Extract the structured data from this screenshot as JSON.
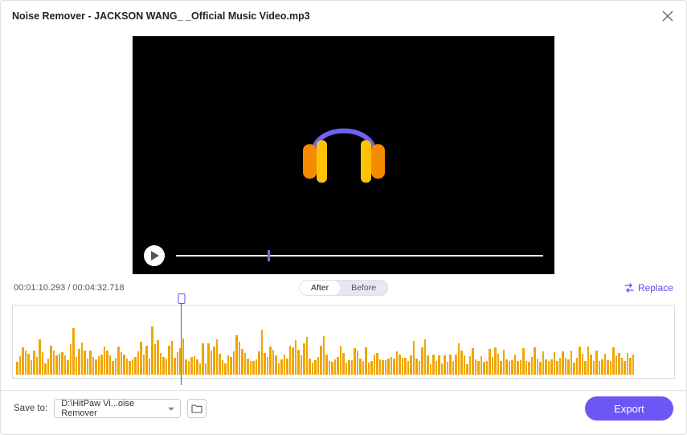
{
  "header": {
    "title": "Noise Remover - JACKSON WANG_ _Official Music Video.mp3"
  },
  "player": {
    "progress_percent": 25
  },
  "timecodes": {
    "current": "00:01:10.293",
    "total": "00:04:32.718",
    "separator": " / "
  },
  "toggle": {
    "after": "After",
    "before": "Before",
    "active": "after"
  },
  "replace_label": "Replace",
  "playhead_percent": 25.5,
  "waveform_heights": [
    16,
    23,
    34,
    30,
    26,
    18,
    30,
    22,
    44,
    28,
    14,
    20,
    36,
    30,
    24,
    26,
    28,
    24,
    18,
    38,
    58,
    22,
    32,
    40,
    30,
    20,
    30,
    22,
    19,
    23,
    25,
    35,
    30,
    24,
    17,
    21,
    35,
    28,
    25,
    20,
    17,
    19,
    22,
    29,
    41,
    25,
    36,
    20,
    60,
    38,
    43,
    27,
    22,
    20,
    36,
    42,
    21,
    28,
    33,
    45,
    19,
    17,
    22,
    23,
    19,
    14,
    39,
    14,
    39,
    30,
    35,
    44,
    26,
    18,
    14,
    24,
    22,
    29,
    49,
    41,
    32,
    27,
    20,
    17,
    17,
    19,
    29,
    56,
    27,
    22,
    35,
    31,
    24,
    14,
    19,
    25,
    20,
    36,
    34,
    43,
    31,
    24,
    39,
    47,
    20,
    15,
    18,
    22,
    36,
    48,
    25,
    17,
    16,
    19,
    22,
    36,
    27,
    15,
    18,
    18,
    33,
    30,
    20,
    17,
    34,
    15,
    17,
    25,
    27,
    19,
    18,
    18,
    20,
    22,
    20,
    29,
    25,
    21,
    21,
    17,
    24,
    42,
    20,
    17,
    34,
    44,
    24,
    13,
    25,
    17,
    24,
    14,
    24,
    16,
    25,
    17,
    25,
    39,
    30,
    24,
    13,
    23,
    33,
    19,
    17,
    23,
    16,
    17,
    32,
    22,
    34,
    26,
    17,
    31,
    19,
    17,
    18,
    25,
    17,
    18,
    33,
    17,
    16,
    22,
    34,
    20,
    16,
    29,
    19,
    17,
    19,
    28,
    17,
    21,
    29,
    21,
    19,
    30,
    15,
    21,
    35,
    26,
    17,
    35,
    25,
    17,
    30,
    17,
    19,
    26,
    18,
    17,
    34,
    24,
    27,
    21,
    17,
    27,
    21,
    25
  ],
  "footer": {
    "save_to_label": "Save to:",
    "save_path": "D:\\HitPaw Vi...oise Remover",
    "export_label": "Export"
  }
}
